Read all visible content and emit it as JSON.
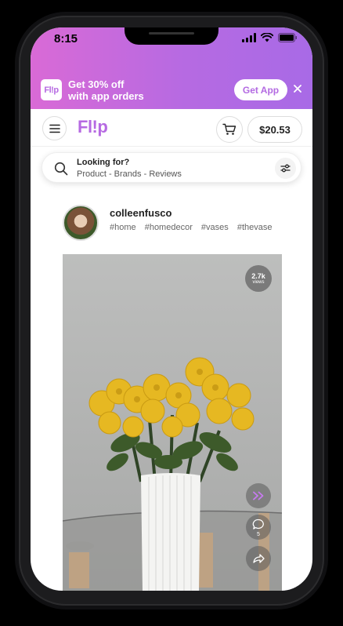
{
  "status_bar": {
    "time": "8:15"
  },
  "banner": {
    "logo_text": "Fl!p",
    "line1": "Get 30% off",
    "line2": "with app orders",
    "cta_label": "Get App"
  },
  "header": {
    "logo": "Fl!p",
    "balance": "$20.53"
  },
  "search": {
    "title": "Looking for?",
    "subtitle": "Product - Brands - Reviews"
  },
  "post": {
    "username": "colleenfusco",
    "tags": [
      "#home",
      "#homedecor",
      "#vases",
      "#thevase"
    ],
    "views_count": "2.7k",
    "views_label": "views",
    "comment_count": "5"
  },
  "colors": {
    "brand": "#b66ae2",
    "gradient_start": "#d96ad6",
    "gradient_end": "#a86ae6"
  }
}
